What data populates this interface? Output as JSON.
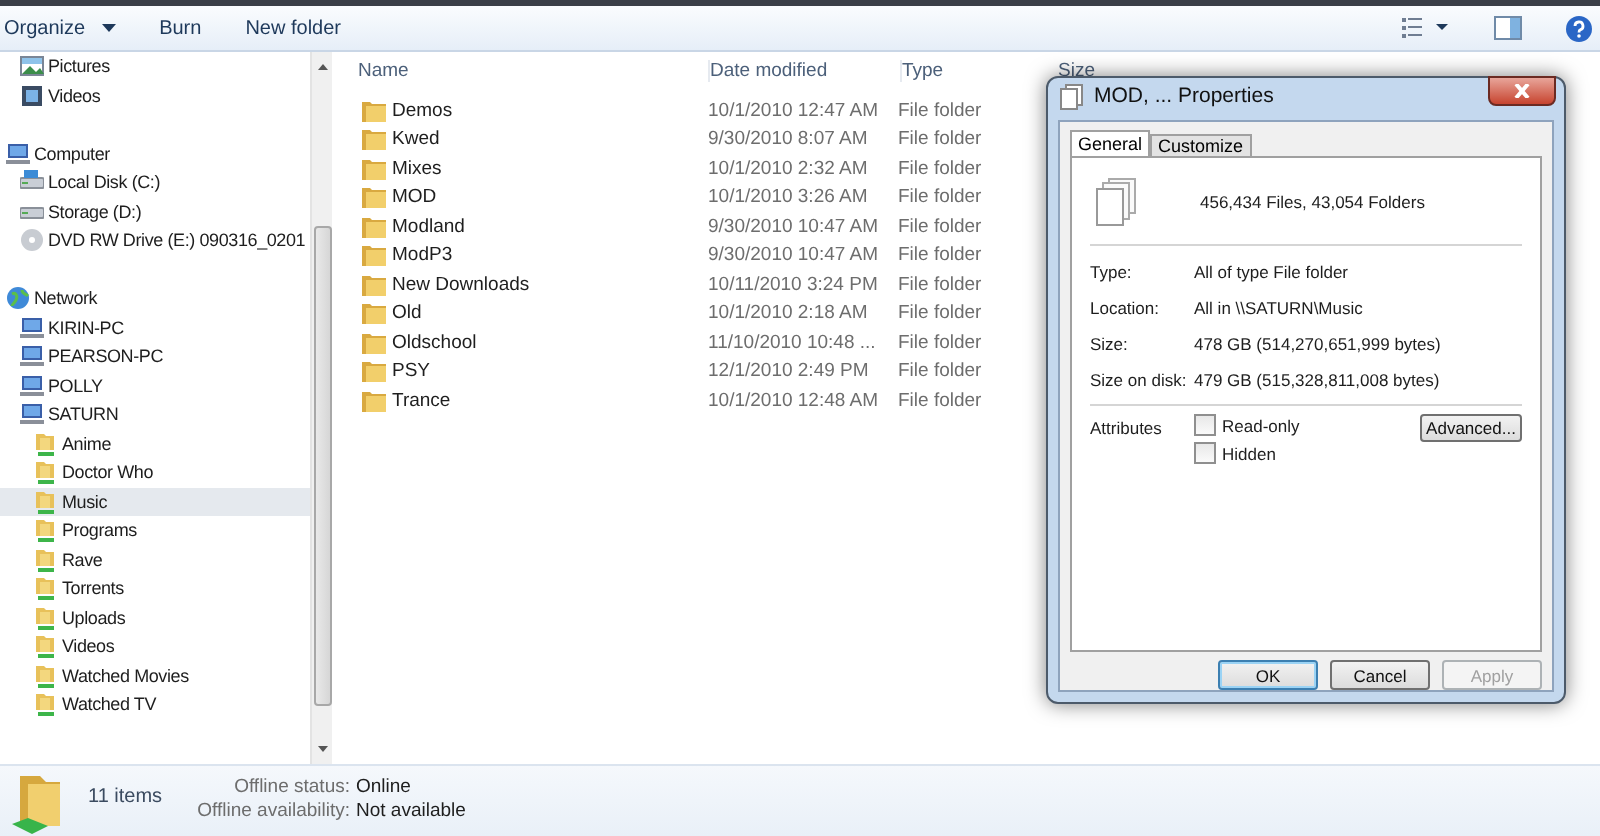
{
  "toolbar": {
    "buttons": [
      {
        "label": "Organize",
        "menu": true
      },
      {
        "label": "Burn",
        "menu": false
      },
      {
        "label": "New folder",
        "menu": false
      }
    ]
  },
  "nav": {
    "library_items": [
      {
        "label": "Pictures",
        "kind": "pictures",
        "selected": false
      },
      {
        "label": "Videos",
        "kind": "videos",
        "selected": false
      }
    ],
    "items": [
      {
        "label": "Computer",
        "kind": "computer",
        "selected": false,
        "children": [
          {
            "label": "Local Disk (C:)",
            "kind": "system-disk",
            "selected": false
          },
          {
            "label": "Storage (D:)",
            "kind": "disk",
            "selected": false
          },
          {
            "label": "DVD RW Drive (E:) 090316_0201",
            "kind": "dvd",
            "selected": false
          }
        ]
      },
      {
        "label": "Network",
        "kind": "network",
        "selected": false,
        "children": [
          {
            "label": "KIRIN-PC",
            "kind": "pc",
            "selected": false
          },
          {
            "label": "PEARSON-PC",
            "kind": "pc",
            "selected": false
          },
          {
            "label": "POLLY",
            "kind": "pc",
            "selected": false
          },
          {
            "label": "SATURN",
            "kind": "pc",
            "selected": false,
            "children": [
              {
                "label": "Anime",
                "kind": "share",
                "selected": false
              },
              {
                "label": "Doctor Who",
                "kind": "share",
                "selected": false
              },
              {
                "label": "Music",
                "kind": "share",
                "selected": true
              },
              {
                "label": "Programs",
                "kind": "share",
                "selected": false
              },
              {
                "label": "Rave",
                "kind": "share",
                "selected": false
              },
              {
                "label": "Torrents",
                "kind": "share",
                "selected": false
              },
              {
                "label": "Uploads",
                "kind": "share",
                "selected": false
              },
              {
                "label": "Videos",
                "kind": "share",
                "selected": false
              },
              {
                "label": "Watched Movies",
                "kind": "share",
                "selected": false
              },
              {
                "label": "Watched TV",
                "kind": "share",
                "selected": false
              }
            ]
          }
        ]
      }
    ]
  },
  "table": {
    "columns": [
      "Name",
      "Date modified",
      "Type",
      "Size"
    ],
    "rows": [
      {
        "name": "Demos",
        "date": "10/1/2010 12:47 AM",
        "type": "File folder"
      },
      {
        "name": "Kwed",
        "date": "9/30/2010 8:07 AM",
        "type": "File folder"
      },
      {
        "name": "Mixes",
        "date": "10/1/2010 2:32 AM",
        "type": "File folder"
      },
      {
        "name": "MOD",
        "date": "10/1/2010 3:26 AM",
        "type": "File folder"
      },
      {
        "name": "Modland",
        "date": "9/30/2010 10:47 AM",
        "type": "File folder"
      },
      {
        "name": "ModP3",
        "date": "9/30/2010 10:47 AM",
        "type": "File folder"
      },
      {
        "name": "New Downloads",
        "date": "10/11/2010 3:24 PM",
        "type": "File folder"
      },
      {
        "name": "Old",
        "date": "10/1/2010 2:18 AM",
        "type": "File folder"
      },
      {
        "name": "Oldschool",
        "date": "11/10/2010 10:48 ...",
        "type": "File folder"
      },
      {
        "name": "PSY",
        "date": "12/1/2010 2:49 PM",
        "type": "File folder"
      },
      {
        "name": "Trance",
        "date": "10/1/2010 12:48 AM",
        "type": "File folder"
      }
    ]
  },
  "status_bar": {
    "count": "11 items",
    "fields": [
      {
        "label": "Offline status:",
        "value": "Online"
      },
      {
        "label": "Offline availability:",
        "value": "Not available"
      }
    ]
  },
  "dialog": {
    "title": "MOD, ... Properties",
    "tabs": [
      {
        "label": "General",
        "selected": true
      },
      {
        "label": "Customize",
        "selected": false
      }
    ],
    "summary": "456,434 Files, 43,054 Folders",
    "properties": [
      {
        "label": "Type:",
        "value": "All of type File folder"
      },
      {
        "label": "Location:",
        "value": "All in \\\\SATURN\\Music"
      },
      {
        "label": "Size:",
        "value": "478 GB (514,270,651,999 bytes)"
      },
      {
        "label": "Size on disk:",
        "value": "479 GB (515,328,811,008 bytes)"
      }
    ],
    "attributes_label": "Attributes",
    "attributes": [
      {
        "label": "Read-only",
        "checked": false
      },
      {
        "label": "Hidden",
        "checked": false
      }
    ],
    "advanced_button": "Advanced...",
    "buttons": [
      {
        "label": "OK",
        "default": true,
        "disabled": false
      },
      {
        "label": "Cancel",
        "default": false,
        "disabled": false
      },
      {
        "label": "Apply",
        "default": false,
        "disabled": true
      }
    ]
  }
}
